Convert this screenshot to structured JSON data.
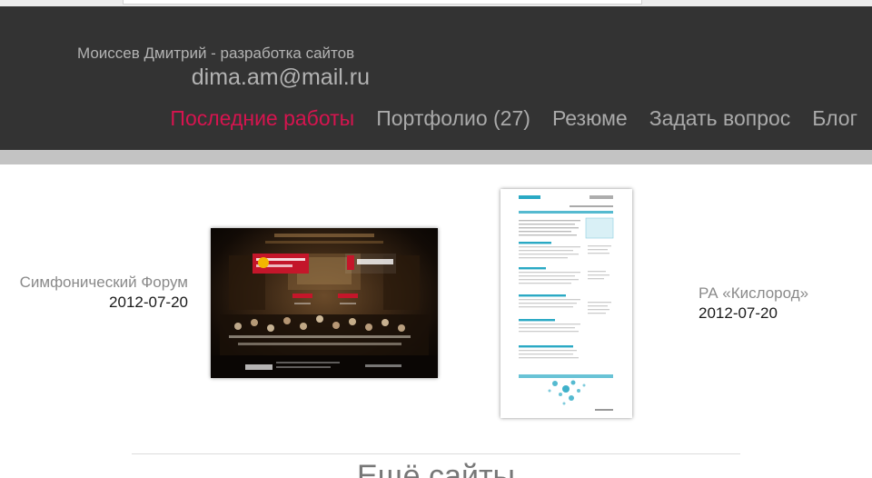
{
  "header": {
    "owner": "Моиссев Дмитрий - разработка сайтов",
    "email": "dima.am@mail.ru",
    "nav": [
      {
        "label": "Последние работы",
        "active": true
      },
      {
        "label": "Портфолио (27)",
        "active": false
      },
      {
        "label": "Резюме",
        "active": false
      },
      {
        "label": "Задать вопрос",
        "active": false
      },
      {
        "label": "Блог",
        "active": false
      }
    ]
  },
  "works": [
    {
      "title": "Симфонический Форум",
      "date": "2012-07-20"
    },
    {
      "title": "РА «Кислород»",
      "date": "2012-07-20"
    }
  ],
  "more": {
    "heading": "Ещё сайты"
  },
  "colors": {
    "header_bg": "#333333",
    "accent": "#d6144f",
    "nav_text": "#aaaaaa",
    "kislorod_accent": "#2aa9c4"
  }
}
